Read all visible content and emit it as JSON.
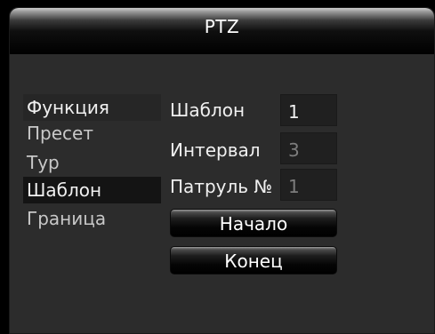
{
  "window": {
    "title": "PTZ"
  },
  "menu": {
    "items": [
      {
        "label": "Функция"
      },
      {
        "label": "Пресет"
      },
      {
        "label": "Тур"
      },
      {
        "label": "Шаблон"
      },
      {
        "label": "Граница"
      }
    ],
    "selected": "Шаблон"
  },
  "form": {
    "pattern": {
      "label": "Шаблон",
      "value": "1"
    },
    "interval": {
      "label": "Интервал",
      "value": "3"
    },
    "patrol": {
      "label": "Патруль №",
      "value": "1"
    }
  },
  "buttons": {
    "start": "Начало",
    "end": "Конец"
  }
}
